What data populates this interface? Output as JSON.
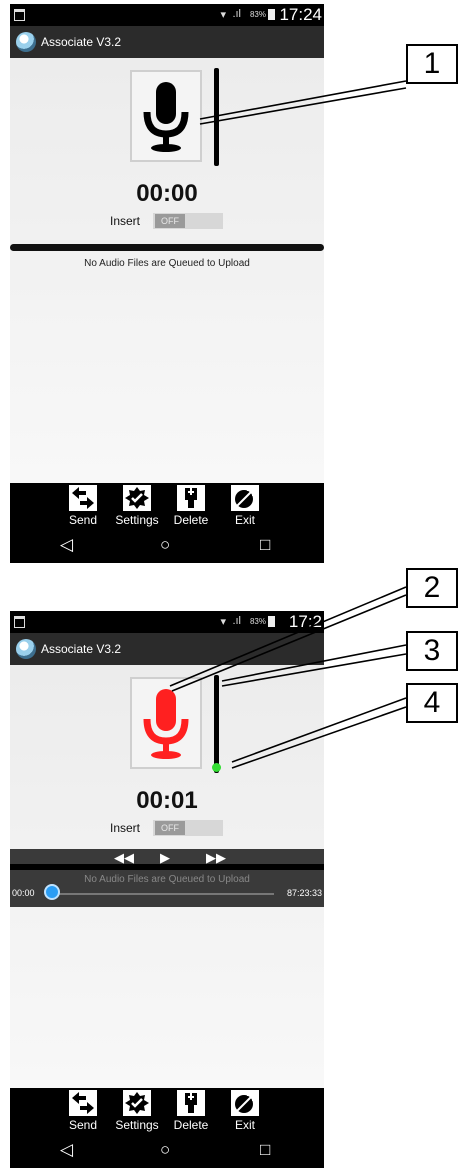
{
  "screens": [
    {
      "status": {
        "battery": "83%",
        "time": "17:24"
      },
      "app_title": "Associate V3.2",
      "mic_state": "idle",
      "mic_color": "#000000",
      "timer": "00:00",
      "insert": {
        "label": "Insert",
        "value": "OFF"
      },
      "queue_message": "No Audio Files are Queued to Upload",
      "actions": [
        {
          "label": "Send",
          "icon": "send-arrows-icon"
        },
        {
          "label": "Settings",
          "icon": "settings-gear-icon"
        },
        {
          "label": "Delete",
          "icon": "delete-trash-icon"
        },
        {
          "label": "Exit",
          "icon": "exit-door-icon"
        }
      ]
    },
    {
      "status": {
        "battery": "83%",
        "time": "17:2"
      },
      "app_title": "Associate V3.2",
      "mic_state": "recording",
      "mic_color": "#ff2020",
      "timer": "00:01",
      "insert": {
        "label": "Insert",
        "value": "OFF"
      },
      "queue_message": "No Audio Files are Queued to Upload",
      "player": {
        "rewind": "◀◀",
        "play": "▶",
        "forward": "▶▶",
        "position": "00:00",
        "duration": "87:23:33",
        "progress": 0
      },
      "actions": [
        {
          "label": "Send",
          "icon": "send-arrows-icon"
        },
        {
          "label": "Settings",
          "icon": "settings-gear-icon"
        },
        {
          "label": "Delete",
          "icon": "delete-trash-icon"
        },
        {
          "label": "Exit",
          "icon": "exit-door-icon"
        }
      ]
    }
  ],
  "navbar": {
    "back": "◁",
    "home": "○",
    "recents": "□"
  },
  "callouts": [
    "1",
    "2",
    "3",
    "4"
  ],
  "colors": {
    "record_active": "#ff2020",
    "level_ok": "#33dd33",
    "seek_knob": "#2a9df4"
  }
}
